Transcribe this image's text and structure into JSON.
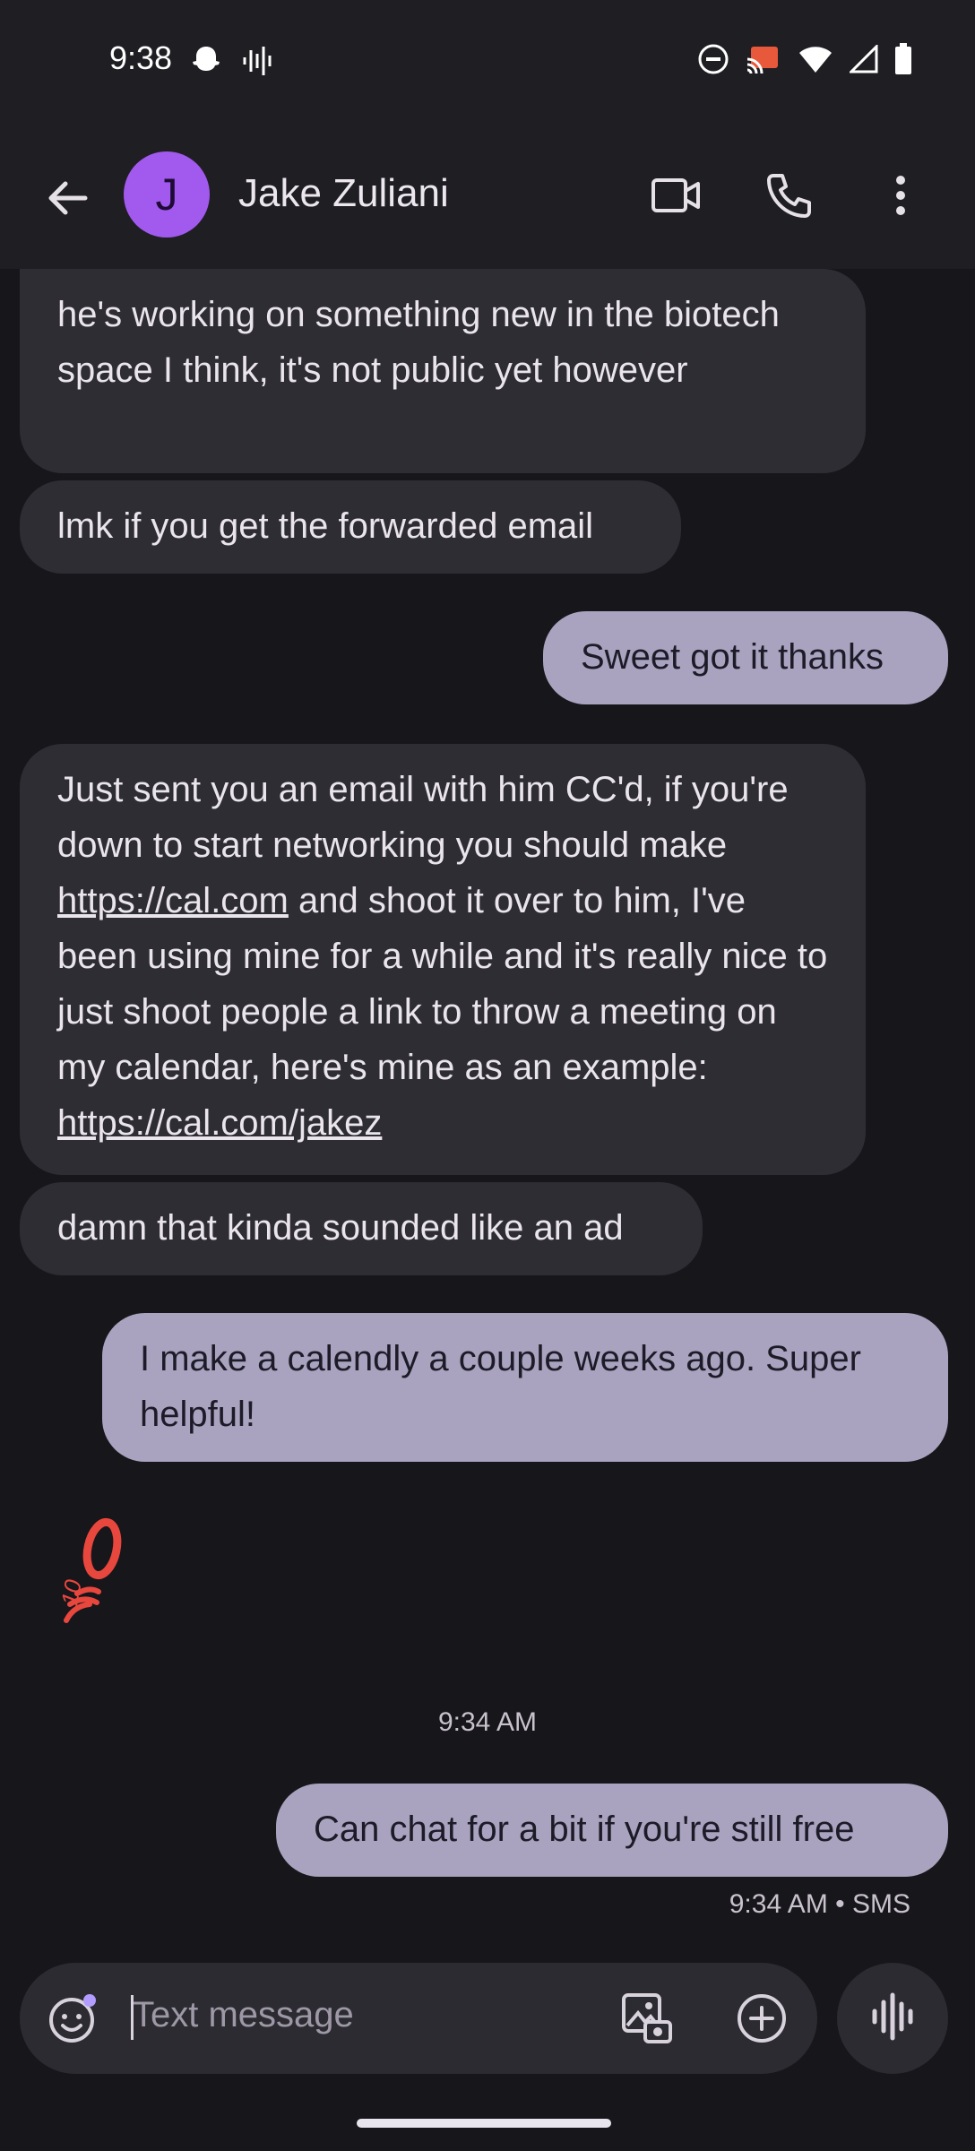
{
  "status_bar": {
    "time": "9:38"
  },
  "header": {
    "avatar_letter": "J",
    "contact_name": "Jake Zuliani"
  },
  "messages": [
    {
      "direction": "incoming",
      "text": "he's working on something new in the biotech space I think, it's not public yet however"
    },
    {
      "direction": "incoming",
      "text": "lmk if you get the forwarded email"
    },
    {
      "direction": "outgoing",
      "text": "Sweet got it thanks"
    },
    {
      "direction": "incoming",
      "part1": "Just sent you an email with him CC'd, if you're down to start networking you should make ",
      "link1": "https://cal.com",
      "part2": " and shoot it over to him, I've been using mine for a while and it's really nice to just shoot people a link to throw a meeting on my calendar, here's mine as an example: ",
      "link2": "https://cal.com/jakez"
    },
    {
      "direction": "incoming",
      "text": "damn that kinda sounded like an ad"
    },
    {
      "direction": "outgoing",
      "text": "I make a calendly a couple weeks ago. Super helpful!"
    },
    {
      "direction": "incoming",
      "type": "sticker",
      "icon": "hundred-emoji-icon"
    },
    {
      "direction": "outgoing",
      "text": "Can chat for a bit if you're still free"
    }
  ],
  "timestamps": {
    "divider": "9:34 AM",
    "last_message_meta": "9:34 AM • SMS"
  },
  "composer": {
    "placeholder": "Text message"
  },
  "colors": {
    "background": "#17161b",
    "incoming_bubble": "#2e2d33",
    "outgoing_bubble": "#a9a3bf",
    "avatar": "#a259ee",
    "sticker": "#e8473d"
  }
}
